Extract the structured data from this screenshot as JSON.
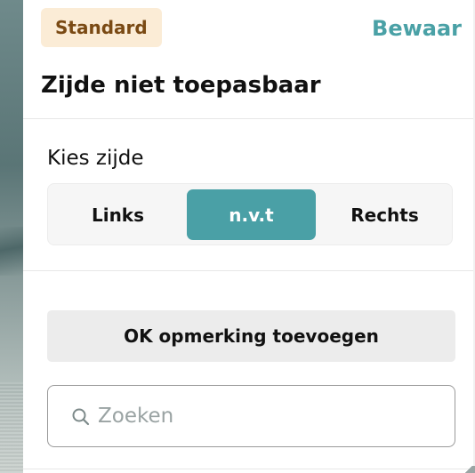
{
  "header": {
    "badge": "Standard",
    "save_label": "Bewaar",
    "title": "Zijde niet toepasbaar"
  },
  "side_selector": {
    "label": "Kies zijde",
    "options": [
      "Links",
      "n.v.t",
      "Rechts"
    ],
    "selected": "n.v.t"
  },
  "actions": {
    "add_remark_label": "OK opmerking toevoegen"
  },
  "search": {
    "placeholder": "Zoeken",
    "value": ""
  },
  "colors": {
    "accent": "#4aa0a6",
    "badge_bg": "#fbecd6",
    "badge_text": "#7a4a14"
  },
  "icons": {
    "search": "search-icon"
  }
}
